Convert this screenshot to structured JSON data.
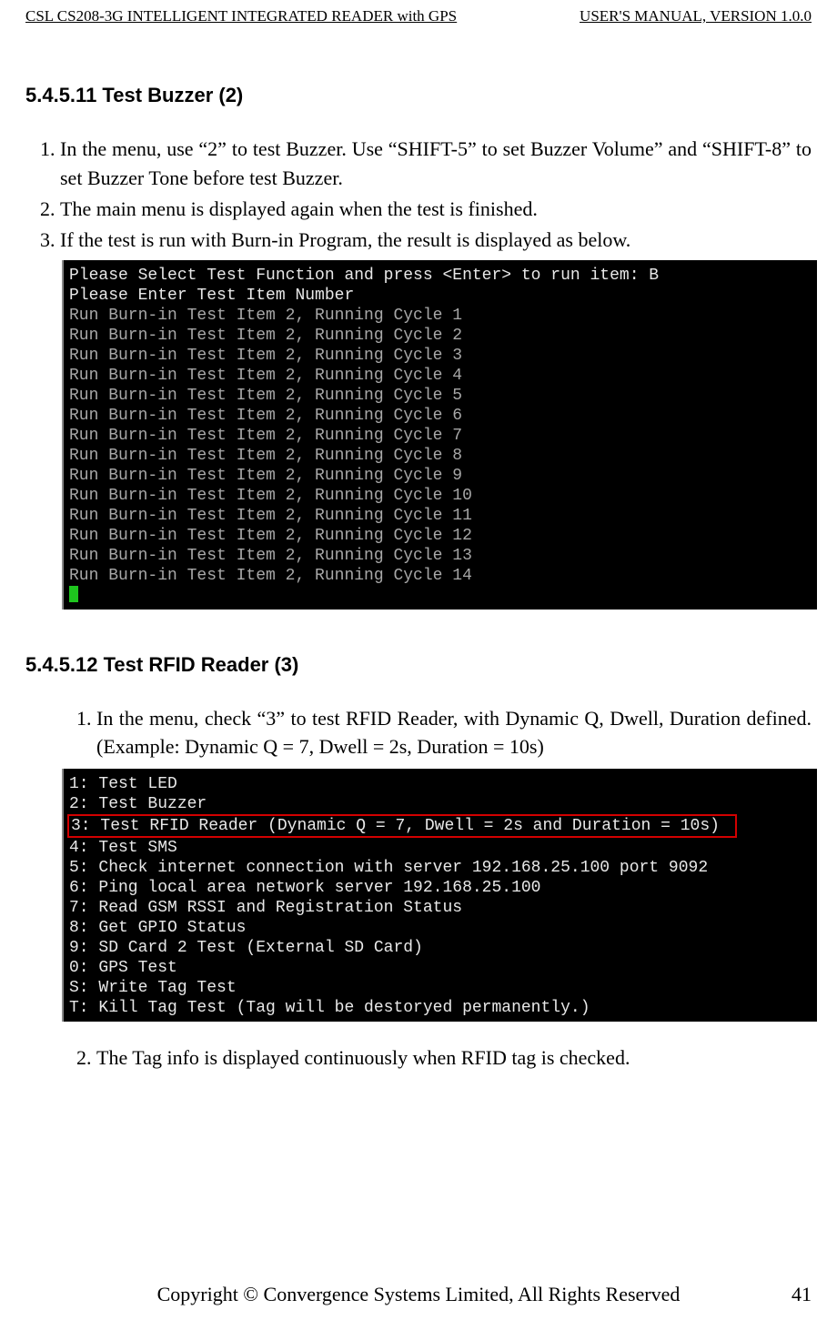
{
  "header": {
    "left": "CSL CS208-3G INTELLIGENT INTEGRATED READER with GPS",
    "right": "USER'S  MANUAL,  VERSION  1.0.0"
  },
  "s1": {
    "head": "5.4.5.11    Test Buzzer (2)",
    "items": [
      "In the menu, use “2” to test Buzzer. Use “SHIFT-5” to set Buzzer Volume” and “SHIFT-8” to set Buzzer Tone before test Buzzer.",
      "The main menu is displayed again when the test is finished.",
      "If the test is run with Burn-in Program, the result is displayed as below."
    ]
  },
  "term1": {
    "l01": "Please Select Test Function and press <Enter> to run item: B",
    "l02": "Please Enter Test Item Number",
    "c01": "Run Burn-in Test Item 2, Running Cycle 1",
    "c02": "Run Burn-in Test Item 2, Running Cycle 2",
    "c03": "Run Burn-in Test Item 2, Running Cycle 3",
    "c04": "Run Burn-in Test Item 2, Running Cycle 4",
    "c05": "Run Burn-in Test Item 2, Running Cycle 5",
    "c06": "Run Burn-in Test Item 2, Running Cycle 6",
    "c07": "Run Burn-in Test Item 2, Running Cycle 7",
    "c08": "Run Burn-in Test Item 2, Running Cycle 8",
    "c09": "Run Burn-in Test Item 2, Running Cycle 9",
    "c10": "Run Burn-in Test Item 2, Running Cycle 10",
    "c11": "Run Burn-in Test Item 2, Running Cycle 11",
    "c12": "Run Burn-in Test Item 2, Running Cycle 12",
    "c13": "Run Burn-in Test Item 2, Running Cycle 13",
    "c14": "Run Burn-in Test Item 2, Running Cycle 14"
  },
  "s2": {
    "head": "5.4.5.12    Test RFID Reader (3)",
    "items": [
      "In  the  menu,  check  “3”  to  test  RFID  Reader,  with  Dynamic  Q,  Dwell,  Duration defined. (Example: Dynamic Q = 7, Dwell = 2s, Duration = 10s)",
      "The Tag info is displayed continuously when RFID tag is checked."
    ]
  },
  "term2": {
    "l01": "1: Test LED",
    "l02": "2: Test Buzzer",
    "l03": "3: Test RFID Reader (Dynamic Q = 7, Dwell = 2s and Duration = 10s) ",
    "l04": "4: Test SMS",
    "l05": "5: Check internet connection with server 192.168.25.100 port 9092",
    "l06": "6: Ping local area network server 192.168.25.100",
    "l07": "7: Read GSM RSSI and Registration Status",
    "l08": "8: Get GPIO Status",
    "l09": "9: SD Card 2 Test (External SD Card)",
    "l10": "0: GPS Test",
    "l11": "S: Write Tag Test",
    "l12": "T: Kill Tag Test (Tag will be destoryed permanently.)"
  },
  "footer": {
    "center": "Copyright © Convergence Systems Limited, All Rights Reserved",
    "page": "41"
  }
}
